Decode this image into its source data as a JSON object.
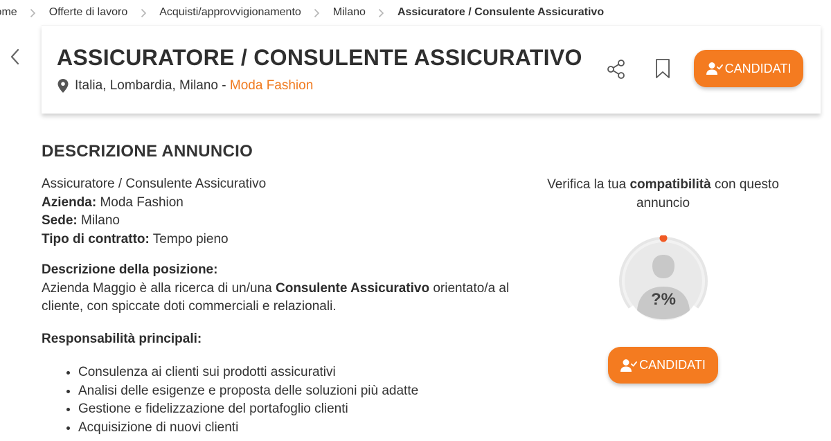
{
  "breadcrumb": {
    "items": [
      "Home",
      "Offerte di lavoro",
      "Acquisti/approvvigionamento",
      "Milano"
    ],
    "current": "Assicuratore / Consulente Assicurativo"
  },
  "header": {
    "title": "ASSICURATORE / CONSULENTE ASSICURATIVO",
    "location": "Italia, Lombardia, Milano -",
    "company": "Moda Fashion",
    "apply_label": "CANDIDATI"
  },
  "description": {
    "section_title": "DESCRIZIONE ANNUNCIO",
    "role_line": "Assicuratore / Consulente Assicurativo",
    "company_label": "Azienda:",
    "company_value": "Moda Fashion",
    "site_label": "Sede:",
    "site_value": "Milano",
    "contract_label": "Tipo di contratto:",
    "contract_value": "Tempo pieno",
    "position_heading": "Descrizione della posizione:",
    "position_text_1": "Azienda Maggio è alla ricerca di un/una",
    "position_text_bold": "Consulente Assicurativo",
    "position_text_2": "orientato/a al cliente, con spiccate doti commerciali e relazionali.",
    "responsibilities_heading": "Responsabilità principali:",
    "responsibilities": [
      "Consulenza ai clienti sui prodotti assicurativi",
      "Analisi delle esigenze e proposta delle soluzioni più adatte",
      "Gestione e fidelizzazione del portafoglio clienti",
      "Acquisizione di nuovi clienti"
    ]
  },
  "compatibility": {
    "text_1": "Verifica la tua",
    "text_bold": "compatibilità",
    "text_2": "con questo annuncio",
    "score": "?%",
    "apply_label": "CANDIDATI"
  },
  "colors": {
    "accent": "#f47b20",
    "link": "#f07a1f",
    "text": "#333333"
  }
}
